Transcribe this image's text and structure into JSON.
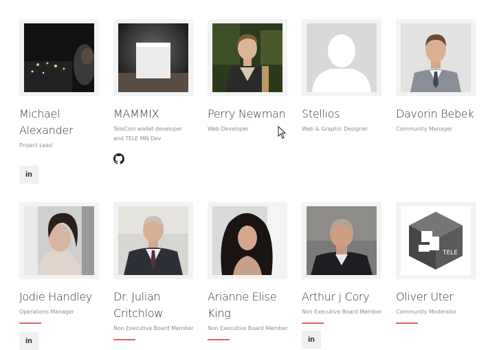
{
  "team": [
    {
      "name": "Michael\nAlexander",
      "role": "Project Lead",
      "social": "in"
    },
    {
      "name": "MAMMIX",
      "role": "TeleCoin wallet developer and TELE MN Dev",
      "social": "github-icon"
    },
    {
      "name": "Perry Newman",
      "role": "Web Developer"
    },
    {
      "name": "Stellios",
      "role": "Web & Graphic Designer"
    },
    {
      "name": "Davorin Bebek",
      "role": "Community Manager"
    },
    {
      "name": "Jodie Handley",
      "role": "Operations Manager",
      "social": "in"
    },
    {
      "name": "Dr. Julian Critchlow",
      "role": "Non Executive Board Member"
    },
    {
      "name": "Arianne Elise King",
      "role": "Non Executive Board Member"
    },
    {
      "name": "Arthur j Cory",
      "role": "Non Executive Board Member",
      "social": "in"
    },
    {
      "name": "Oliver Uter",
      "role": "Community Moderator"
    }
  ],
  "logo_text": "TELE",
  "colors": {
    "accent": "#e85d64",
    "frame": "#f3f3f3"
  }
}
